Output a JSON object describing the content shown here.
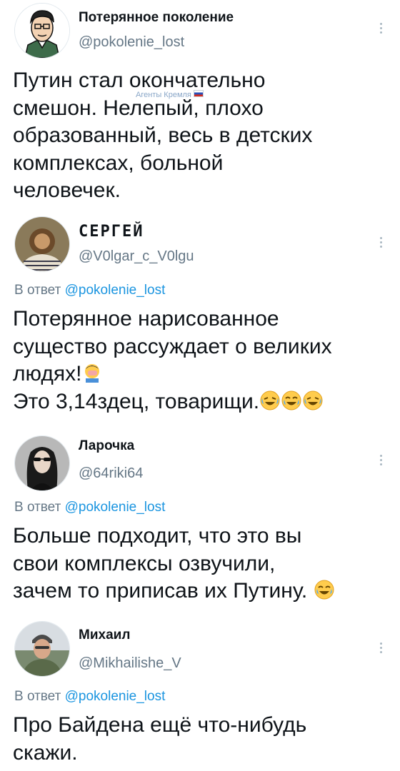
{
  "tweets": [
    {
      "name": "Потерянное поколение",
      "handle": "@pokolenie_lost",
      "lines": [
        "Путин стал окончательно",
        "смешон. Нелепый, плохо",
        "образованный, весь в детских",
        "комплексах, больной",
        "человечек."
      ]
    },
    {
      "name": "СЕРГЕЙ",
      "handle": "@V0lgar_c_V0lgu",
      "reply_prefix": "В ответ",
      "reply_to": "@pokolenie_lost",
      "lines": [
        "Потерянное нарисованное",
        "существо рассуждает о великих",
        "людях!",
        "Это 3,14здец, товарищи."
      ],
      "emojis": [
        "facepalm-emoji",
        "rofl-emoji",
        "joy-emoji",
        "rofl-emoji"
      ]
    },
    {
      "name": "Ларочка",
      "handle": "@64riki64",
      "reply_prefix": "В ответ",
      "reply_to": "@pokolenie_lost",
      "lines": [
        "Больше подходит, что это вы",
        "свои комплексы озвучили,",
        "зачем то приписав их Путину."
      ],
      "emojis": [
        "joy-emoji"
      ]
    },
    {
      "name": "Михаил",
      "handle": "@Mikhailishe_V",
      "reply_prefix": "В ответ",
      "reply_to": "@pokolenie_lost",
      "lines": [
        "Про Байдена ещё что-нибудь",
        "скажи."
      ]
    }
  ],
  "watermark": "Агенты Кремля",
  "colors": {
    "text": "#0f1419",
    "secondary": "#657786",
    "mention": "#1b95e0",
    "background": "#ffffff"
  }
}
